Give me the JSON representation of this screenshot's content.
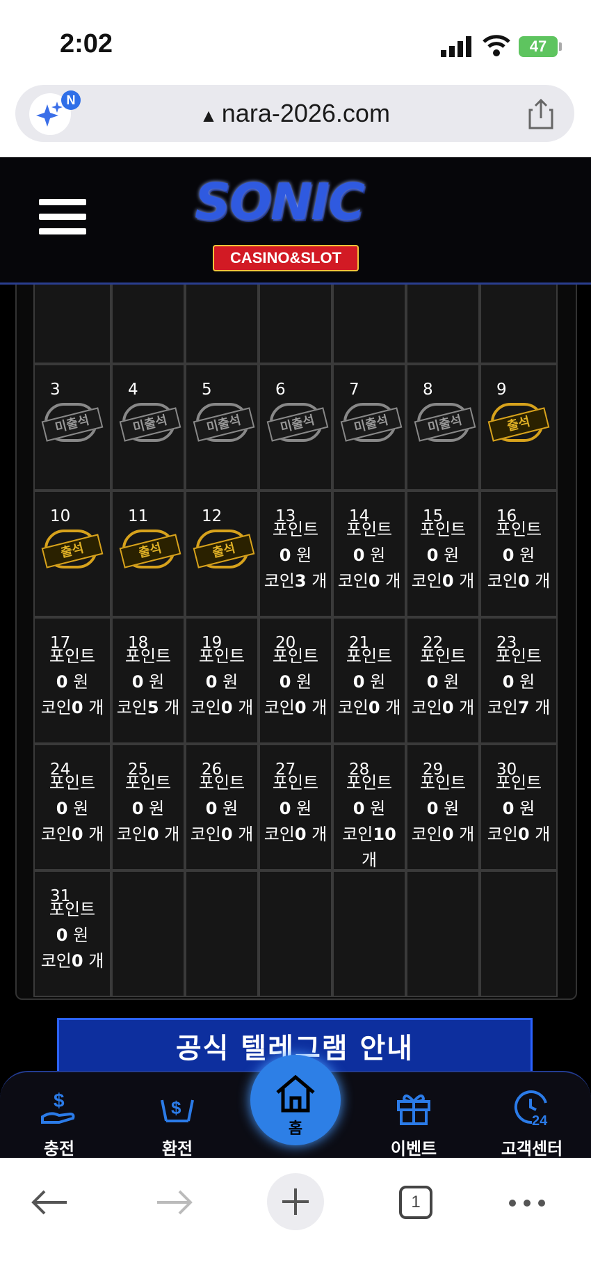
{
  "status_bar": {
    "time": "2:02",
    "battery": "47"
  },
  "address_bar": {
    "url": "nara-2026.com",
    "badge": "N"
  },
  "header": {
    "logo_title": "SONIC",
    "logo_tagline": "CASINO&SLOT"
  },
  "calendar": {
    "stamp_absent": "미출석",
    "stamp_present": "출석",
    "point_label": "포인트",
    "won_unit": "원",
    "coin_label": "코인",
    "coin_unit": "개",
    "days": [
      {
        "day": "3",
        "status": "absent"
      },
      {
        "day": "4",
        "status": "absent"
      },
      {
        "day": "5",
        "status": "absent"
      },
      {
        "day": "6",
        "status": "absent"
      },
      {
        "day": "7",
        "status": "absent"
      },
      {
        "day": "8",
        "status": "absent"
      },
      {
        "day": "9",
        "status": "present"
      },
      {
        "day": "10",
        "status": "present"
      },
      {
        "day": "11",
        "status": "present"
      },
      {
        "day": "12",
        "status": "present"
      },
      {
        "day": "13",
        "points": "0",
        "coins": "3"
      },
      {
        "day": "14",
        "points": "0",
        "coins": "0"
      },
      {
        "day": "15",
        "points": "0",
        "coins": "0"
      },
      {
        "day": "16",
        "points": "0",
        "coins": "0"
      },
      {
        "day": "17",
        "points": "0",
        "coins": "0"
      },
      {
        "day": "18",
        "points": "0",
        "coins": "5"
      },
      {
        "day": "19",
        "points": "0",
        "coins": "0"
      },
      {
        "day": "20",
        "points": "0",
        "coins": "0"
      },
      {
        "day": "21",
        "points": "0",
        "coins": "0"
      },
      {
        "day": "22",
        "points": "0",
        "coins": "0"
      },
      {
        "day": "23",
        "points": "0",
        "coins": "7"
      },
      {
        "day": "24",
        "points": "0",
        "coins": "0"
      },
      {
        "day": "25",
        "points": "0",
        "coins": "0"
      },
      {
        "day": "26",
        "points": "0",
        "coins": "0"
      },
      {
        "day": "27",
        "points": "0",
        "coins": "0"
      },
      {
        "day": "28",
        "points": "0",
        "coins": "10"
      },
      {
        "day": "29",
        "points": "0",
        "coins": "0"
      },
      {
        "day": "30",
        "points": "0",
        "coins": "0"
      },
      {
        "day": "31",
        "points": "0",
        "coins": "0"
      }
    ]
  },
  "banner": {
    "title": "공식 텔레그램 안내"
  },
  "bottom_nav": {
    "deposit": "충전",
    "withdraw": "환전",
    "home": "홈",
    "event": "이벤트",
    "support": "고객센터"
  },
  "browser": {
    "tab_count": "1"
  }
}
